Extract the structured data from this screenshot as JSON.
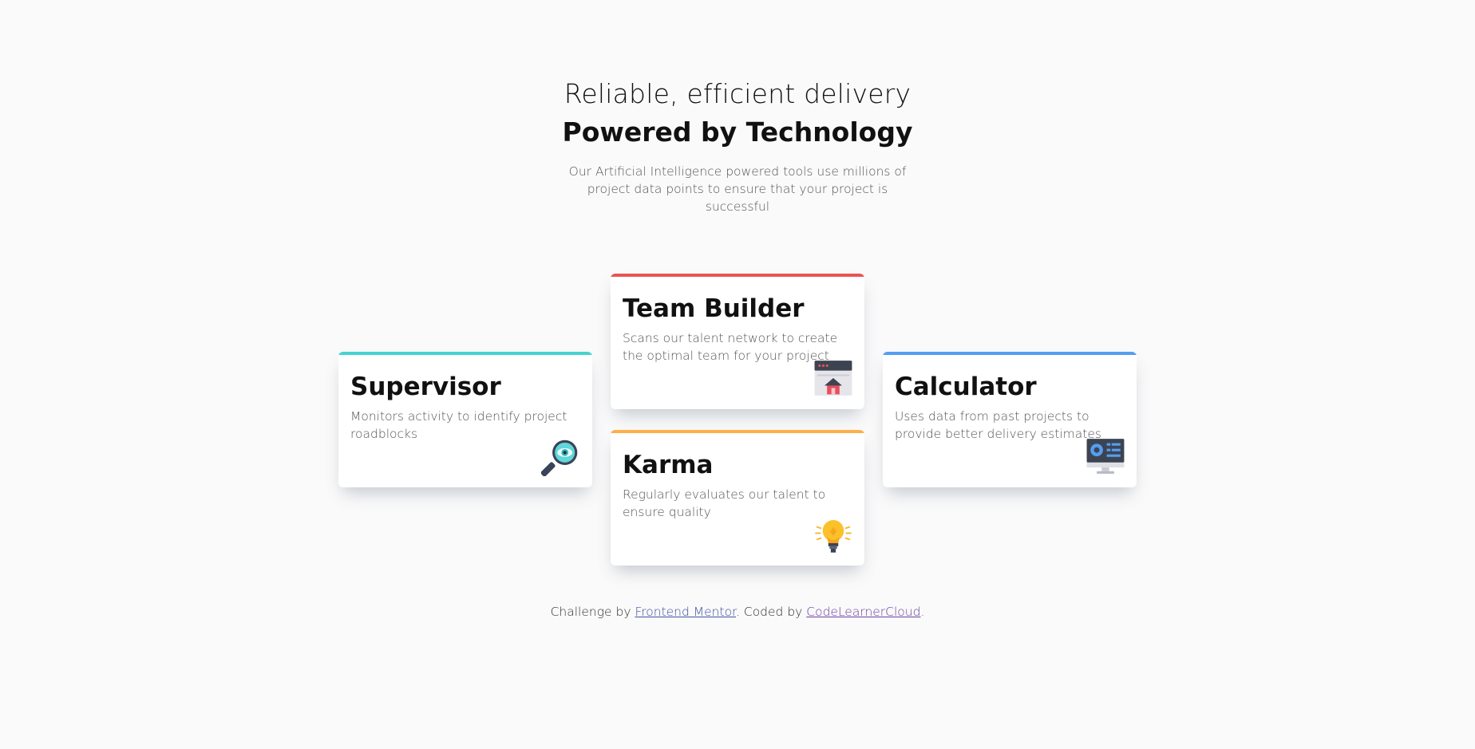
{
  "hero": {
    "subtitle": "Reliable, efficient delivery",
    "title": "Powered by Technology",
    "description": "Our Artificial Intelligence powered tools use millions of project data points to ensure that your project is successful"
  },
  "cards": {
    "supervisor": {
      "title": "Supervisor",
      "text": "Monitors activity to identify project roadblocks",
      "accent": "#44d3d2",
      "icon": "magnifier-eye-icon"
    },
    "team_builder": {
      "title": "Team Builder",
      "text": "Scans our talent network to create the optimal team for your project",
      "accent": "#ea5454",
      "icon": "team-builder-icon"
    },
    "karma": {
      "title": "Karma",
      "text": "Regularly evaluates our talent to ensure quality",
      "accent": "#fcaf4a",
      "icon": "lightbulb-icon"
    },
    "calculator": {
      "title": "Calculator",
      "text": "Uses data from past projects to provide better delivery estimates",
      "accent": "#549ef2",
      "icon": "calculator-monitor-icon"
    }
  },
  "footer": {
    "prefix": "Challenge by ",
    "link1": "Frontend Mentor",
    "middle": ". Coded by ",
    "link2": "CodeLearnerCloud",
    "suffix": "."
  }
}
